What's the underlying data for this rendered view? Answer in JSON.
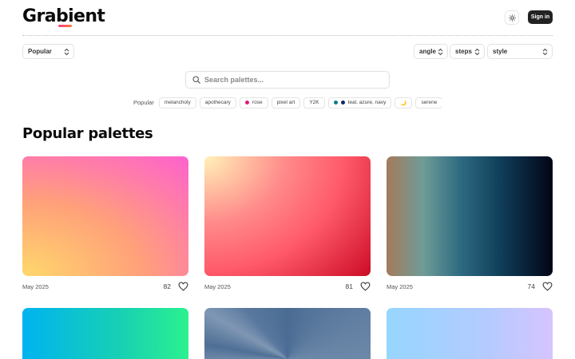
{
  "header": {
    "logo": "Grabient",
    "signin_label": "Sign in",
    "theme_icon": "sun-icon"
  },
  "filters": {
    "sort_value": "Popular",
    "angle_label": "angle",
    "steps_label": "steps",
    "style_label": "style"
  },
  "search": {
    "placeholder": "Search palettes..."
  },
  "tags": {
    "label": "Popular",
    "items": [
      {
        "label": "melancholy"
      },
      {
        "label": "apothecary"
      },
      {
        "label": "rose",
        "dot_color": "#e0197d"
      },
      {
        "label": "pixel art"
      },
      {
        "label": "Y2K"
      },
      {
        "label": "teal, azure, navy",
        "dot_colors": [
          "#0e7c86",
          "#0b2a6b"
        ]
      },
      {
        "label": "🌙"
      },
      {
        "label": "serene"
      }
    ]
  },
  "section": {
    "title": "Popular palettes"
  },
  "palettes": [
    {
      "date": "May 2025",
      "likes": "82"
    },
    {
      "date": "May 2025",
      "likes": "81"
    },
    {
      "date": "May 2025",
      "likes": "74"
    },
    {
      "date": "",
      "likes": ""
    },
    {
      "date": "",
      "likes": ""
    },
    {
      "date": "",
      "likes": ""
    }
  ],
  "colors": {
    "accent_dark": "#222222",
    "tag_rose": "#e0197d",
    "tag_teal": "#0e7c86",
    "tag_navy": "#0b2a6b"
  }
}
